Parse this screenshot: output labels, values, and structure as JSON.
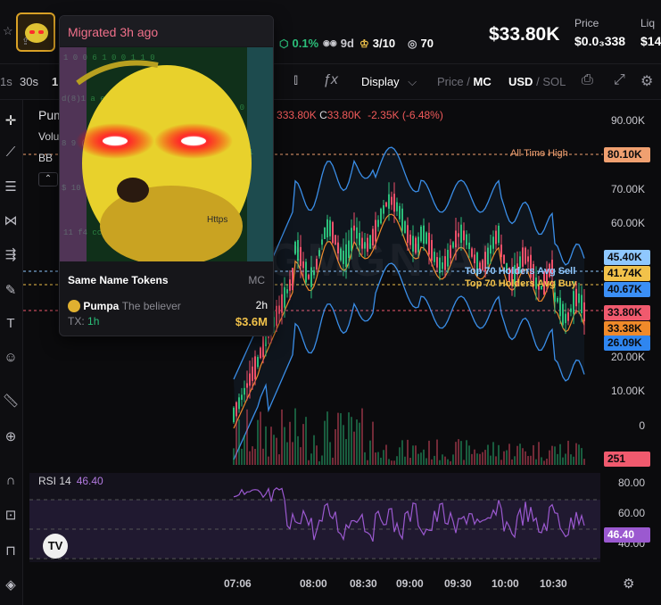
{
  "header": {
    "price": "$33.80K",
    "stats": {
      "change": "0.1%",
      "age": "9d",
      "score": "3/10",
      "views": "70"
    },
    "price_label": "Price",
    "price_value": "$0.0₃338",
    "liq_label": "Liq",
    "liq_value": "$14"
  },
  "toolbar": {
    "intervals": [
      "1s",
      "30s",
      "1"
    ],
    "display_label": "Display",
    "price_label": "Price",
    "mc_label": "MC",
    "usd_label": "USD",
    "sol_label": "SOL"
  },
  "chart": {
    "pair_prefix": "Pum",
    "volume_prefix": "Volu",
    "bb_prefix": "BB",
    "ohlc": {
      "h_prefix": "3",
      "h_value": "33.80K",
      "c_label": "C",
      "c_value": "33.80K",
      "change": "-2.35K (-6.48%)"
    },
    "watermark": "GMGN.AI",
    "ath_label": "All Time High",
    "sell_label": "Top 70 Holders Avg Sell",
    "buy_label": "Top 70 Holders Avg Buy",
    "y_ticks": [
      "90.00K",
      "70.00K",
      "60.00K",
      "20.00K",
      "10.00K",
      "0"
    ],
    "price_tags": [
      {
        "label": "80.10K",
        "color": "#f0a070"
      },
      {
        "label": "45.40K",
        "color": "#8fc8ff"
      },
      {
        "label": "41.74K",
        "color": "#f2c24a"
      },
      {
        "label": "40.67K",
        "color": "#3b8ff5"
      },
      {
        "label": "33.80K",
        "color": "#f05a6e"
      },
      {
        "label": "33.38K",
        "color": "#f08a2a"
      },
      {
        "label": "26.09K",
        "color": "#2f86f0"
      },
      {
        "label": "251",
        "color": "#f05a6e"
      }
    ],
    "rsi": {
      "label": "RSI 14",
      "value": "46.40",
      "ticks": [
        "80.00",
        "60.00",
        "40.00"
      ]
    },
    "x_ticks": [
      "07:06",
      "08:00",
      "08:30",
      "09:00",
      "09:30",
      "10:00",
      "10:30"
    ]
  },
  "popup": {
    "title": "Migrated 3h ago",
    "image_caption": "Https",
    "section_title": "Same Name Tokens",
    "section_col": "MC",
    "item": {
      "name": "Pumpa",
      "desc": "The believer",
      "age": "2h",
      "tx_label": "TX:",
      "tx_value": "1h",
      "mc": "$3.6M"
    }
  },
  "colors": {
    "up": "#2bbf7a",
    "down": "#f0506a",
    "bb": "#3a8ee8",
    "ma": "#f08a2a",
    "rsi": "#9b59d0"
  },
  "icons": [
    "star-icon",
    "share-icon",
    "leaf-icon",
    "crown-icon",
    "eye-icon",
    "candle-type-icon",
    "formula-icon",
    "camera-icon",
    "fullscreen-icon",
    "settings-icon",
    "crosshair-icon",
    "trendline-icon",
    "fib-icon",
    "pattern-icon",
    "measure-icon",
    "brush-icon",
    "text-icon",
    "emoji-icon",
    "ruler-icon",
    "zoom-icon",
    "magnet-icon",
    "lock-icon",
    "eye-hide-icon"
  ]
}
